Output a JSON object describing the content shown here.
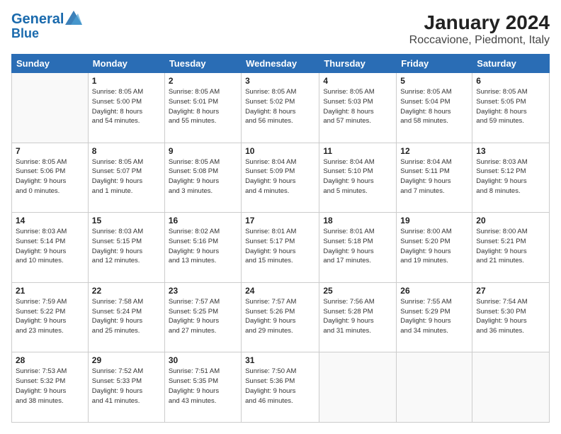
{
  "header": {
    "logo_line1": "General",
    "logo_line2": "Blue",
    "title": "January 2024",
    "subtitle": "Roccavione, Piedmont, Italy"
  },
  "columns": [
    "Sunday",
    "Monday",
    "Tuesday",
    "Wednesday",
    "Thursday",
    "Friday",
    "Saturday"
  ],
  "weeks": [
    [
      {
        "day": "",
        "info": ""
      },
      {
        "day": "1",
        "info": "Sunrise: 8:05 AM\nSunset: 5:00 PM\nDaylight: 8 hours\nand 54 minutes."
      },
      {
        "day": "2",
        "info": "Sunrise: 8:05 AM\nSunset: 5:01 PM\nDaylight: 8 hours\nand 55 minutes."
      },
      {
        "day": "3",
        "info": "Sunrise: 8:05 AM\nSunset: 5:02 PM\nDaylight: 8 hours\nand 56 minutes."
      },
      {
        "day": "4",
        "info": "Sunrise: 8:05 AM\nSunset: 5:03 PM\nDaylight: 8 hours\nand 57 minutes."
      },
      {
        "day": "5",
        "info": "Sunrise: 8:05 AM\nSunset: 5:04 PM\nDaylight: 8 hours\nand 58 minutes."
      },
      {
        "day": "6",
        "info": "Sunrise: 8:05 AM\nSunset: 5:05 PM\nDaylight: 8 hours\nand 59 minutes."
      }
    ],
    [
      {
        "day": "7",
        "info": "Sunrise: 8:05 AM\nSunset: 5:06 PM\nDaylight: 9 hours\nand 0 minutes."
      },
      {
        "day": "8",
        "info": "Sunrise: 8:05 AM\nSunset: 5:07 PM\nDaylight: 9 hours\nand 1 minute."
      },
      {
        "day": "9",
        "info": "Sunrise: 8:05 AM\nSunset: 5:08 PM\nDaylight: 9 hours\nand 3 minutes."
      },
      {
        "day": "10",
        "info": "Sunrise: 8:04 AM\nSunset: 5:09 PM\nDaylight: 9 hours\nand 4 minutes."
      },
      {
        "day": "11",
        "info": "Sunrise: 8:04 AM\nSunset: 5:10 PM\nDaylight: 9 hours\nand 5 minutes."
      },
      {
        "day": "12",
        "info": "Sunrise: 8:04 AM\nSunset: 5:11 PM\nDaylight: 9 hours\nand 7 minutes."
      },
      {
        "day": "13",
        "info": "Sunrise: 8:03 AM\nSunset: 5:12 PM\nDaylight: 9 hours\nand 8 minutes."
      }
    ],
    [
      {
        "day": "14",
        "info": "Sunrise: 8:03 AM\nSunset: 5:14 PM\nDaylight: 9 hours\nand 10 minutes."
      },
      {
        "day": "15",
        "info": "Sunrise: 8:03 AM\nSunset: 5:15 PM\nDaylight: 9 hours\nand 12 minutes."
      },
      {
        "day": "16",
        "info": "Sunrise: 8:02 AM\nSunset: 5:16 PM\nDaylight: 9 hours\nand 13 minutes."
      },
      {
        "day": "17",
        "info": "Sunrise: 8:01 AM\nSunset: 5:17 PM\nDaylight: 9 hours\nand 15 minutes."
      },
      {
        "day": "18",
        "info": "Sunrise: 8:01 AM\nSunset: 5:18 PM\nDaylight: 9 hours\nand 17 minutes."
      },
      {
        "day": "19",
        "info": "Sunrise: 8:00 AM\nSunset: 5:20 PM\nDaylight: 9 hours\nand 19 minutes."
      },
      {
        "day": "20",
        "info": "Sunrise: 8:00 AM\nSunset: 5:21 PM\nDaylight: 9 hours\nand 21 minutes."
      }
    ],
    [
      {
        "day": "21",
        "info": "Sunrise: 7:59 AM\nSunset: 5:22 PM\nDaylight: 9 hours\nand 23 minutes."
      },
      {
        "day": "22",
        "info": "Sunrise: 7:58 AM\nSunset: 5:24 PM\nDaylight: 9 hours\nand 25 minutes."
      },
      {
        "day": "23",
        "info": "Sunrise: 7:57 AM\nSunset: 5:25 PM\nDaylight: 9 hours\nand 27 minutes."
      },
      {
        "day": "24",
        "info": "Sunrise: 7:57 AM\nSunset: 5:26 PM\nDaylight: 9 hours\nand 29 minutes."
      },
      {
        "day": "25",
        "info": "Sunrise: 7:56 AM\nSunset: 5:28 PM\nDaylight: 9 hours\nand 31 minutes."
      },
      {
        "day": "26",
        "info": "Sunrise: 7:55 AM\nSunset: 5:29 PM\nDaylight: 9 hours\nand 34 minutes."
      },
      {
        "day": "27",
        "info": "Sunrise: 7:54 AM\nSunset: 5:30 PM\nDaylight: 9 hours\nand 36 minutes."
      }
    ],
    [
      {
        "day": "28",
        "info": "Sunrise: 7:53 AM\nSunset: 5:32 PM\nDaylight: 9 hours\nand 38 minutes."
      },
      {
        "day": "29",
        "info": "Sunrise: 7:52 AM\nSunset: 5:33 PM\nDaylight: 9 hours\nand 41 minutes."
      },
      {
        "day": "30",
        "info": "Sunrise: 7:51 AM\nSunset: 5:35 PM\nDaylight: 9 hours\nand 43 minutes."
      },
      {
        "day": "31",
        "info": "Sunrise: 7:50 AM\nSunset: 5:36 PM\nDaylight: 9 hours\nand 46 minutes."
      },
      {
        "day": "",
        "info": ""
      },
      {
        "day": "",
        "info": ""
      },
      {
        "day": "",
        "info": ""
      }
    ]
  ]
}
